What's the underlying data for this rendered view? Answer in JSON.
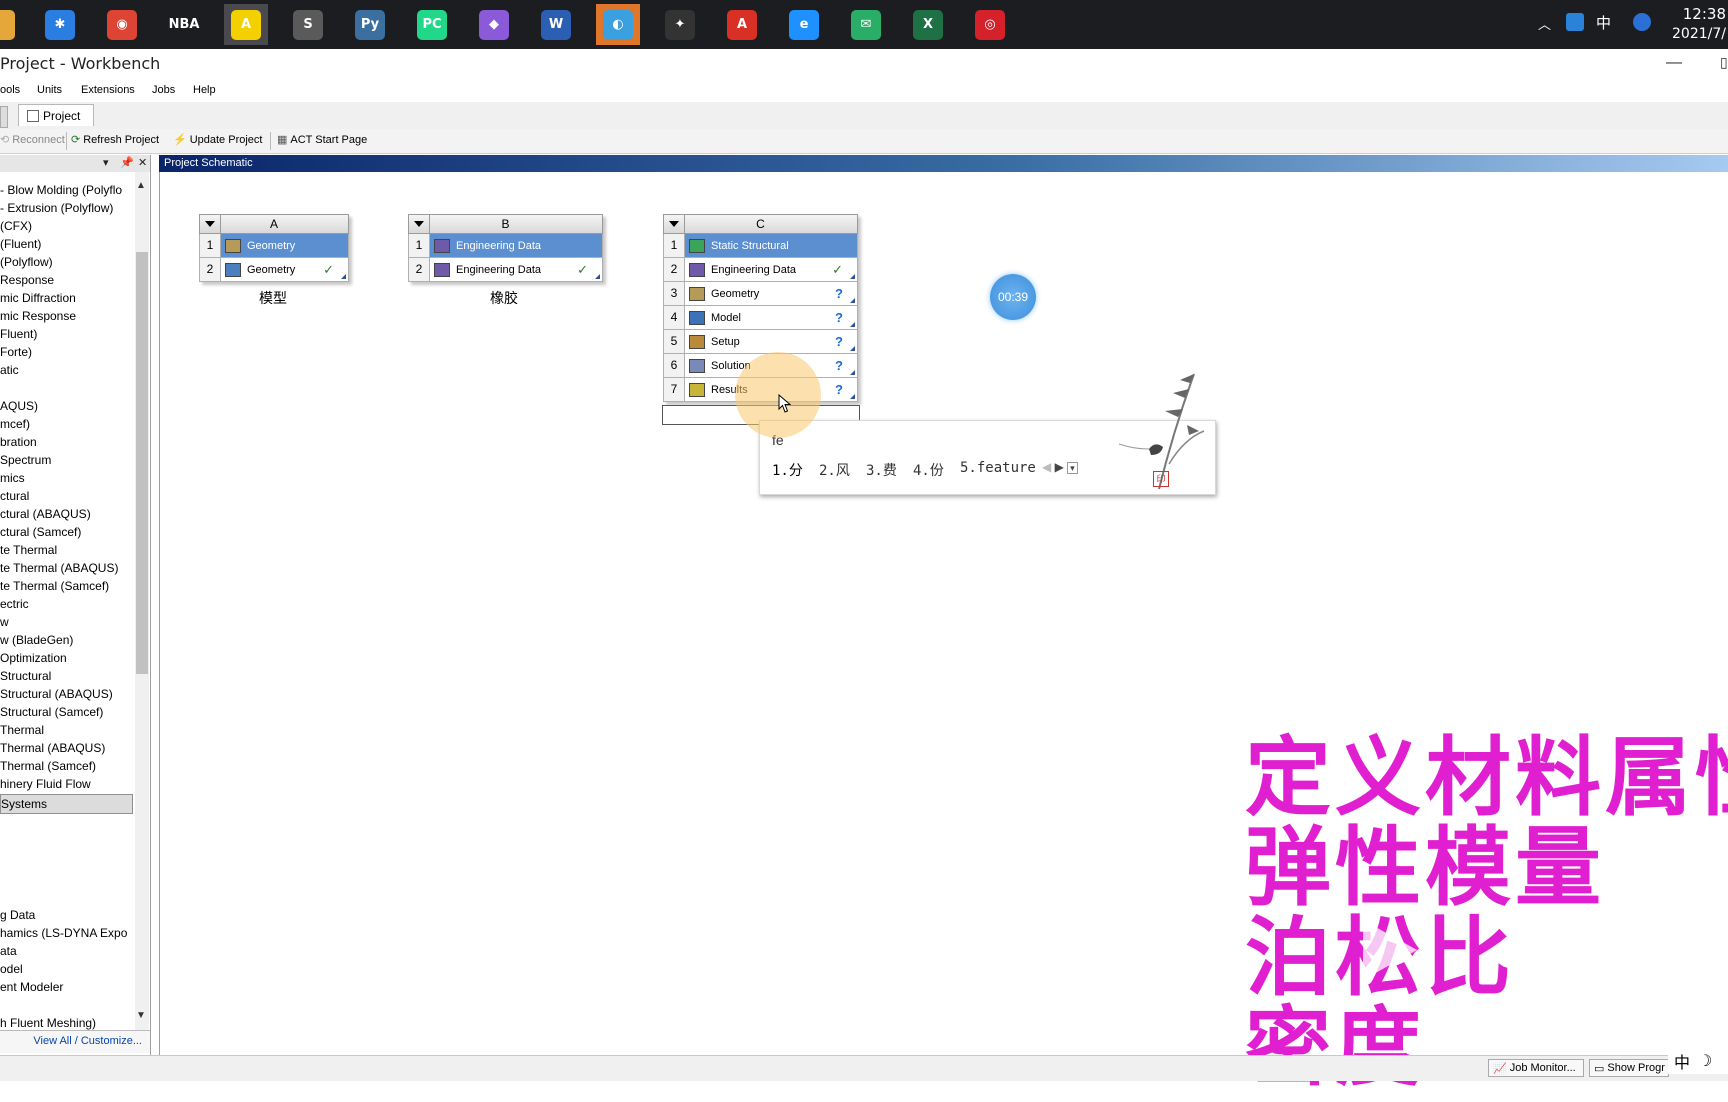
{
  "window": {
    "title": "Project - Workbench"
  },
  "taskbar": {
    "apps": [
      {
        "name": "file-explorer",
        "glyph": "",
        "color": "#e5a73a"
      },
      {
        "name": "star-app",
        "glyph": "✱",
        "color": "#2a7de1"
      },
      {
        "name": "chrome",
        "glyph": "◉",
        "color": "#dd4433"
      },
      {
        "name": "nba2k",
        "glyph": "NBA",
        "color": "#1c1d21"
      },
      {
        "name": "autocad-a",
        "glyph": "A",
        "color": "#f4d000"
      },
      {
        "name": "sublime",
        "glyph": "S",
        "color": "#5a5a5a"
      },
      {
        "name": "python",
        "glyph": "Py",
        "color": "#3b6fa0"
      },
      {
        "name": "pycharm",
        "glyph": "PC",
        "color": "#21d789"
      },
      {
        "name": "vs",
        "glyph": "◆",
        "color": "#8a5ad8"
      },
      {
        "name": "word",
        "glyph": "W",
        "color": "#2b5fb4"
      },
      {
        "name": "ansys-workbench",
        "glyph": "◐",
        "color": "#3aa0e0"
      },
      {
        "name": "media",
        "glyph": "✦",
        "color": "#333"
      },
      {
        "name": "acrobat",
        "glyph": "A",
        "color": "#d93025"
      },
      {
        "name": "ie",
        "glyph": "e",
        "color": "#1e90ff"
      },
      {
        "name": "wechat",
        "glyph": "✉",
        "color": "#2aae67"
      },
      {
        "name": "excel",
        "glyph": "X",
        "color": "#1e7145"
      },
      {
        "name": "netease-music",
        "glyph": "◎",
        "color": "#d4212a"
      }
    ],
    "tray": {
      "lang": "中",
      "time": "12:38",
      "date": "2021/7/"
    }
  },
  "menu": [
    "ools",
    "Units",
    "Extensions",
    "Jobs",
    "Help"
  ],
  "tabs": {
    "project": "Project"
  },
  "toolbar": {
    "reconnect": "Reconnect",
    "refresh": "Refresh Project",
    "update": "Update Project",
    "act": "ACT Start Page"
  },
  "toolbox": {
    "items": [
      "- Blow Molding (Polyflo",
      "- Extrusion (Polyflow)",
      "(CFX)",
      "(Fluent)",
      "(Polyflow)",
      "Response",
      "mic Diffraction",
      "mic Response",
      "Fluent)",
      "Forte)",
      "atic",
      "",
      "AQUS)",
      "mcef)",
      "bration",
      "Spectrum",
      "mics",
      "ctural",
      "ctural (ABAQUS)",
      "ctural (Samcef)",
      "te Thermal",
      "te Thermal (ABAQUS)",
      "te Thermal (Samcef)",
      "ectric",
      "w",
      "w (BladeGen)",
      "Optimization",
      "Structural",
      "Structural (ABAQUS)",
      "Structural (Samcef)",
      "Thermal",
      "Thermal (ABAQUS)",
      "Thermal (Samcef)",
      "hinery Fluid Flow"
    ],
    "separator": "Systems",
    "bottom_items": [
      "g Data",
      "hamics (LS-DYNA Expo",
      "ata",
      "odel",
      "ent Modeler",
      "",
      "h Fluent Meshing)"
    ],
    "view_all": "View All / Customize..."
  },
  "schematic": {
    "title": "Project Schematic",
    "systems": [
      {
        "letter": "A",
        "caption": "模型",
        "cells": [
          {
            "num": "1",
            "label": "Geometry",
            "icon": "geometry-icon",
            "status": "",
            "selected": true
          },
          {
            "num": "2",
            "label": "Geometry",
            "icon": "geometry-cell-icon",
            "status": "✓",
            "selected": false
          }
        ]
      },
      {
        "letter": "B",
        "caption": "橡胶",
        "cells": [
          {
            "num": "1",
            "label": "Engineering Data",
            "icon": "engineering-data-icon",
            "status": "",
            "selected": true
          },
          {
            "num": "2",
            "label": "Engineering Data",
            "icon": "engineering-data-icon",
            "status": "✓",
            "selected": false
          }
        ]
      },
      {
        "letter": "C",
        "caption": "",
        "cells": [
          {
            "num": "1",
            "label": "Static Structural",
            "icon": "static-structural-icon",
            "status": "",
            "selected": true
          },
          {
            "num": "2",
            "label": "Engineering Data",
            "icon": "engineering-data-icon",
            "status": "✓",
            "selected": false
          },
          {
            "num": "3",
            "label": "Geometry",
            "icon": "geometry-icon",
            "status": "?",
            "selected": false
          },
          {
            "num": "4",
            "label": "Model",
            "icon": "model-icon",
            "status": "?",
            "selected": false
          },
          {
            "num": "5",
            "label": "Setup",
            "icon": "setup-icon",
            "status": "?",
            "selected": false
          },
          {
            "num": "6",
            "label": "Solution",
            "icon": "solution-icon",
            "status": "?",
            "selected": false
          },
          {
            "num": "7",
            "label": "Results",
            "icon": "results-icon",
            "status": "?",
            "selected": false
          }
        ]
      }
    ]
  },
  "timer": "00:39",
  "ime": {
    "composition": "fe",
    "candidates": [
      "1.分",
      "2.风",
      "3.费",
      "4.份",
      "5.feature"
    ]
  },
  "overlay": {
    "lines": [
      "定义材料属性",
      "弹性模量",
      "泊松比",
      "密度"
    ]
  },
  "statusbar": {
    "job_monitor": "Job Monitor...",
    "show_progress": "Show Progr"
  },
  "ime_indicator": {
    "lang": "中",
    "moon": "☽"
  },
  "colors": {
    "selected_cell": "#5b8fcf",
    "overlay_text": "#e020d0",
    "schematic_header": "#0a246a"
  }
}
